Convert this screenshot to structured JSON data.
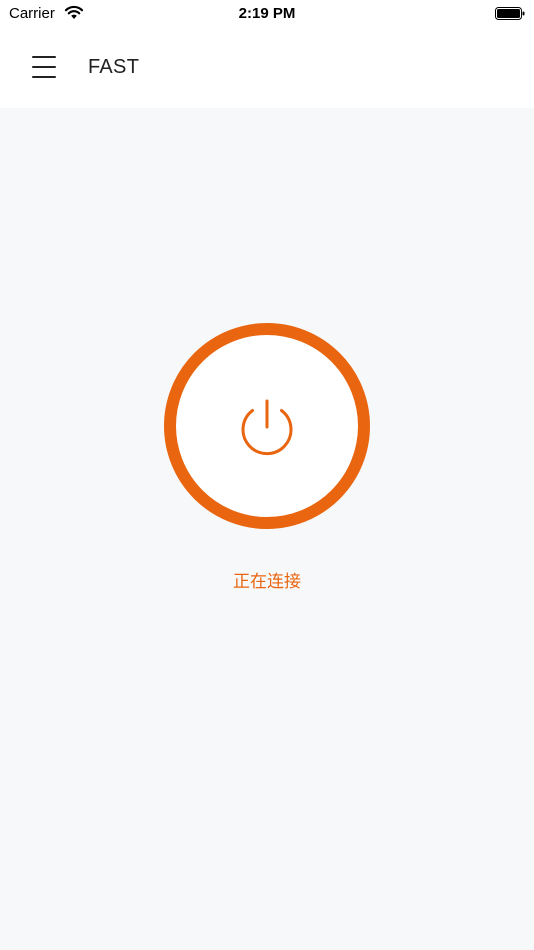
{
  "status_bar": {
    "carrier": "Carrier",
    "time": "2:19 PM"
  },
  "nav": {
    "title": "FAST",
    "menu_icon": "hamburger-menu-icon"
  },
  "main": {
    "power_icon": "power-icon",
    "status_text": "正在连接",
    "accent_color": "#e9650f"
  }
}
